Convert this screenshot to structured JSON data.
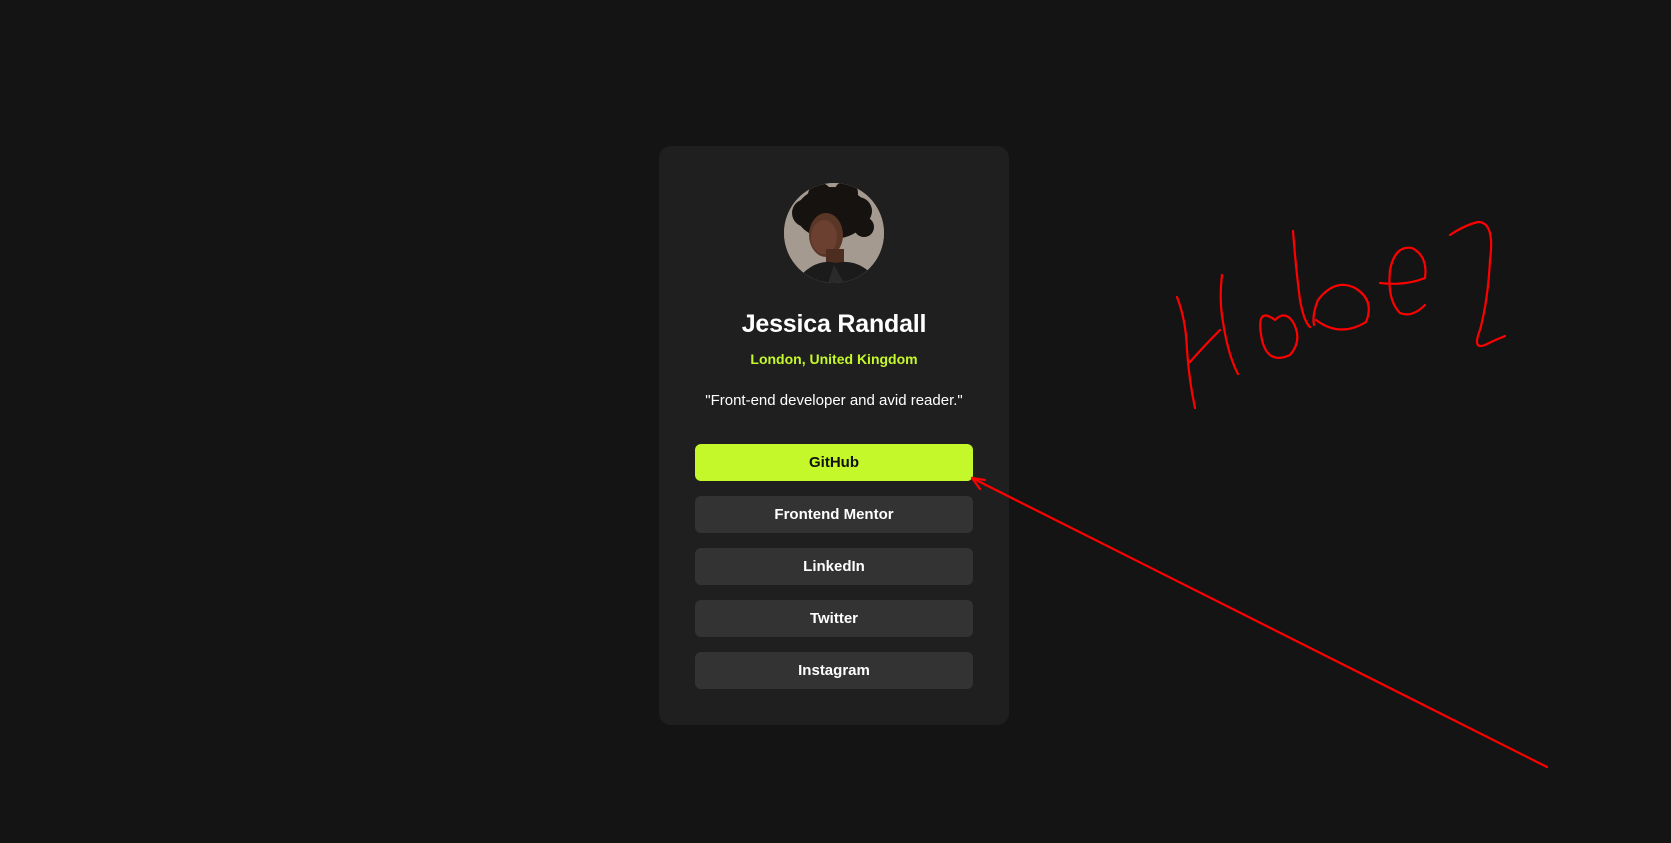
{
  "profile": {
    "name": "Jessica Randall",
    "location": "London, United Kingdom",
    "bio": "\"Front-end developer and avid reader.\""
  },
  "links": [
    {
      "label": "GitHub",
      "active": true
    },
    {
      "label": "Frontend Mentor",
      "active": false
    },
    {
      "label": "LinkedIn",
      "active": false
    },
    {
      "label": "Twitter",
      "active": false
    },
    {
      "label": "Instagram",
      "active": false
    }
  ],
  "colors": {
    "page_background": "#141414",
    "card_background": "#1f1f1f",
    "button_background": "#333333",
    "accent": "#c4f82a",
    "annotation": "#ff0000"
  },
  "annotation": {
    "handwriting": "Hoben",
    "icon": "arrow-icon"
  }
}
